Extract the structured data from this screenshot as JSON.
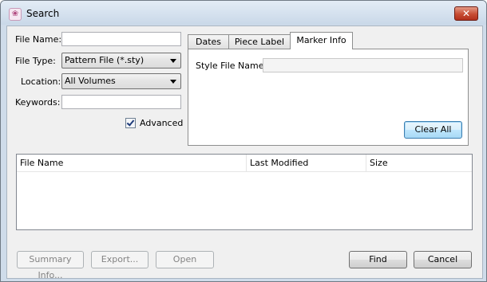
{
  "window": {
    "title": "Search",
    "app_icon": "app-logo-icon",
    "close_glyph": "✕"
  },
  "form": {
    "file_name_label": "File Name:",
    "file_name_value": "",
    "file_type_label": "File Type:",
    "file_type_value": "Pattern File (*.sty)",
    "location_label": "Location:",
    "location_value": "All Volumes",
    "keywords_label": "Keywords:",
    "keywords_value": "",
    "advanced_label": "Advanced",
    "advanced_checked": true
  },
  "tabs": [
    {
      "label": "Dates",
      "active": false
    },
    {
      "label": "Piece Label",
      "active": false
    },
    {
      "label": "Marker Info",
      "active": true
    }
  ],
  "marker_info": {
    "style_file_label": "Style File Name:",
    "style_file_value": "",
    "clear_all_label": "Clear All"
  },
  "results": {
    "columns": [
      "File Name",
      "Last Modified",
      "Size"
    ],
    "rows": []
  },
  "buttons": {
    "summary_info": "Summary Info...",
    "export": "Export...",
    "open": "Open",
    "find": "Find",
    "cancel": "Cancel"
  },
  "colors": {
    "accent": "#3c7fb1",
    "close_button": "#c74c33"
  }
}
